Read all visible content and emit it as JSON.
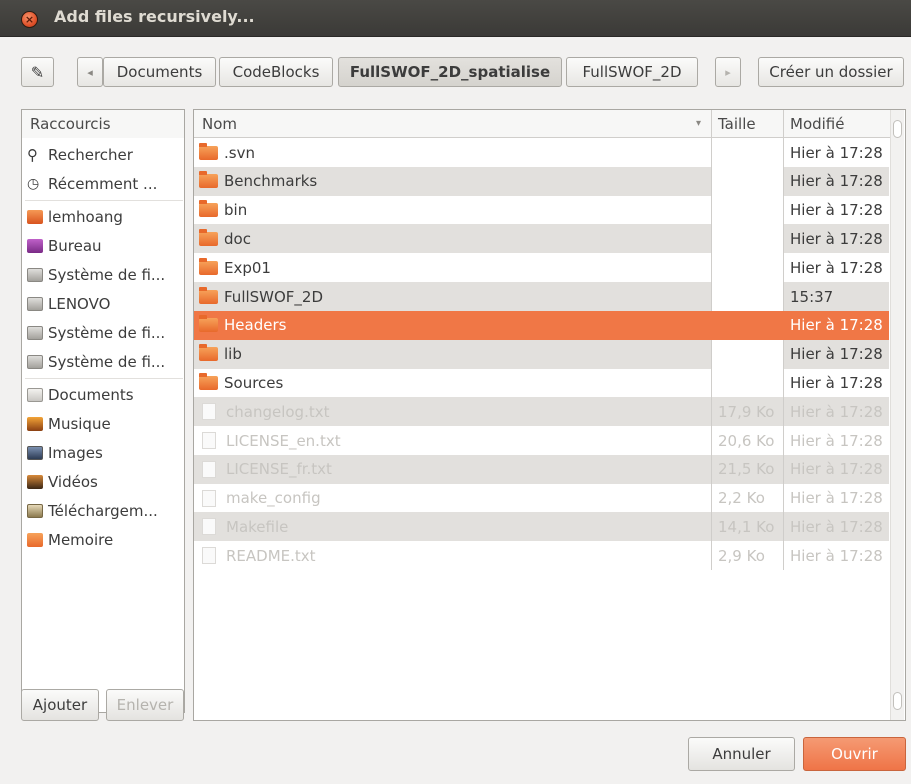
{
  "window": {
    "title": "Add files recursively...",
    "close_icon": "×"
  },
  "toolbar": {
    "edit_icon": "✎",
    "back_icon": "◂",
    "forward_icon": "▸",
    "path": [
      "Documents",
      "CodeBlocks",
      "FullSWOF_2D_spatialise",
      "FullSWOF_2D"
    ],
    "active_index": 2,
    "create_folder": "Créer un dossier"
  },
  "sidebar": {
    "header": "Raccourcis",
    "items": [
      {
        "label": "Rechercher",
        "icon": "search-icon"
      },
      {
        "label": "Récemment ...",
        "icon": "clock-icon"
      },
      {
        "label": "lemhoang",
        "icon": "home-folder-icon"
      },
      {
        "label": "Bureau",
        "icon": "desktop-icon"
      },
      {
        "label": "Système de fi...",
        "icon": "drive-icon"
      },
      {
        "label": "LENOVO",
        "icon": "drive-icon"
      },
      {
        "label": "Système de fi...",
        "icon": "drive-icon"
      },
      {
        "label": "Système de fi...",
        "icon": "drive-icon"
      },
      {
        "label": "Documents",
        "icon": "documents-icon"
      },
      {
        "label": "Musique",
        "icon": "music-icon"
      },
      {
        "label": "Images",
        "icon": "images-icon"
      },
      {
        "label": "Vidéos",
        "icon": "videos-icon"
      },
      {
        "label": "Téléchargem...",
        "icon": "downloads-icon"
      },
      {
        "label": "Memoire",
        "icon": "folder-icon"
      }
    ],
    "add_button": "Ajouter",
    "remove_button": "Enlever"
  },
  "files": {
    "columns": {
      "name": "Nom",
      "size": "Taille",
      "modified": "Modifié",
      "sort_icon": "▾"
    },
    "rows": [
      {
        "name": ".svn",
        "type": "folder",
        "size": "",
        "modified": "Hier à 17:28"
      },
      {
        "name": "Benchmarks",
        "type": "folder",
        "size": "",
        "modified": "Hier à 17:28"
      },
      {
        "name": "bin",
        "type": "folder",
        "size": "",
        "modified": "Hier à 17:28"
      },
      {
        "name": "doc",
        "type": "folder",
        "size": "",
        "modified": "Hier à 17:28"
      },
      {
        "name": "Exp01",
        "type": "folder",
        "size": "",
        "modified": "Hier à 17:28"
      },
      {
        "name": "FullSWOF_2D",
        "type": "folder",
        "size": "",
        "modified": "15:37"
      },
      {
        "name": "Headers",
        "type": "folder",
        "size": "",
        "modified": "Hier à 17:28",
        "selected": true
      },
      {
        "name": "lib",
        "type": "folder",
        "size": "",
        "modified": "Hier à 17:28"
      },
      {
        "name": "Sources",
        "type": "folder",
        "size": "",
        "modified": "Hier à 17:28"
      },
      {
        "name": "changelog.txt",
        "type": "file",
        "size": "17,9 Ko",
        "modified": "Hier à 17:28"
      },
      {
        "name": "LICENSE_en.txt",
        "type": "file",
        "size": "20,6 Ko",
        "modified": "Hier à 17:28"
      },
      {
        "name": "LICENSE_fr.txt",
        "type": "file",
        "size": "21,5 Ko",
        "modified": "Hier à 17:28"
      },
      {
        "name": "make_config",
        "type": "file",
        "size": "2,2 Ko",
        "modified": "Hier à 17:28"
      },
      {
        "name": "Makefile",
        "type": "file",
        "size": "14,1 Ko",
        "modified": "Hier à 17:28"
      },
      {
        "name": "README.txt",
        "type": "file",
        "size": "2,9 Ko",
        "modified": "Hier à 17:28"
      }
    ]
  },
  "buttons": {
    "cancel": "Annuler",
    "open": "Ouvrir"
  },
  "colors": {
    "selection": "#f07746",
    "titlebar": "#3c3b37",
    "folder": "#ee7a39"
  }
}
